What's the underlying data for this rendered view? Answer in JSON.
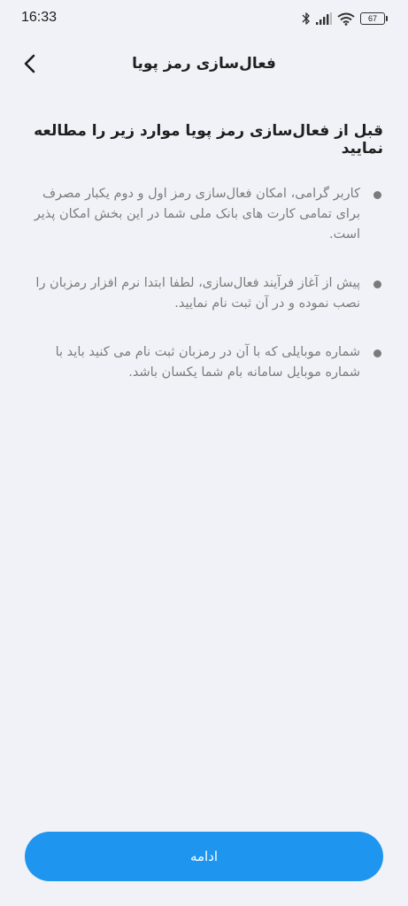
{
  "status_bar": {
    "time": "16:33",
    "battery": "67",
    "icons": [
      "bluetooth-icon",
      "signal-icon",
      "wifi-icon",
      "battery-icon"
    ]
  },
  "app_bar": {
    "title": "فعال‌سازی رمز پویا",
    "back_icon": "chevron-left-icon"
  },
  "main": {
    "heading": "قبل از فعال‌سازی رمز پویا موارد زیر را مطالعه نمایید",
    "items": [
      {
        "text": "کاربر گرامی، امکان فعال‌سازی رمز اول و دوم یکبار مصرف برای تمامی کارت های بانک ملی شما در این بخش امکان پذیر است."
      },
      {
        "text": "پیش از آغاز فرآیند فعال‌سازی، لطفا ابتدا نرم افزار رمزبان را نصب نموده و در آن ثبت نام نمایید."
      },
      {
        "text": "شماره موبایلی که با آن در رمزبان ثبت نام می کنید باید با شماره موبایل سامانه بام شما یکسان باشد."
      }
    ]
  },
  "footer": {
    "continue_label": "ادامه"
  },
  "colors": {
    "background": "#f1f2f7",
    "primary": "#1e96f0",
    "body_text": "#7c7c7c"
  }
}
